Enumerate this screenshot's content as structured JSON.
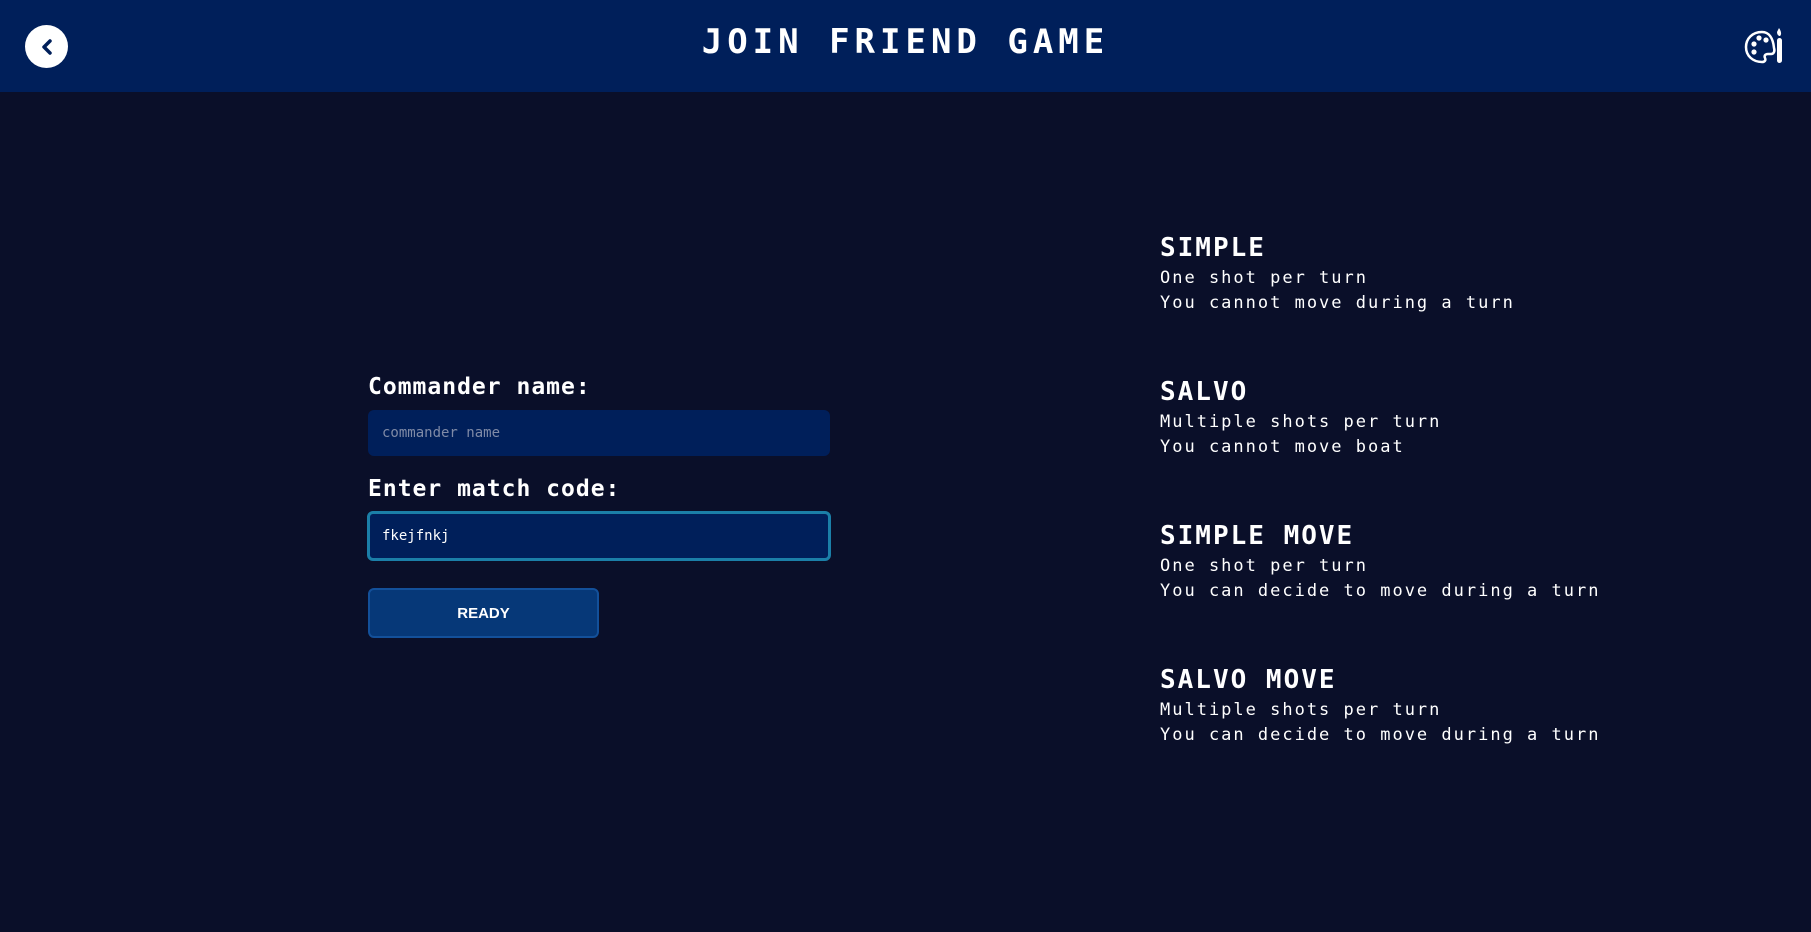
{
  "header": {
    "title": "JOIN FRIEND GAME",
    "back_icon": "chevron-left-icon",
    "theme_icon": "palette-brush-icon"
  },
  "form": {
    "commander_label": "Commander name:",
    "commander_placeholder": "commander name",
    "commander_value": "",
    "code_label": "Enter match code:",
    "code_value": "fkejfnkj",
    "ready_label": "READY"
  },
  "modes": [
    {
      "title": "SIMPLE",
      "lines": [
        "One shot per turn",
        "You cannot move during a turn"
      ]
    },
    {
      "title": "SALVO",
      "lines": [
        "Multiple shots per turn",
        "You cannot move boat"
      ]
    },
    {
      "title": "SIMPLE MOVE",
      "lines": [
        "One shot per turn",
        "You can decide to move during a turn"
      ]
    },
    {
      "title": "SALVO MOVE",
      "lines": [
        "Multiple shots per turn",
        "You can decide to move during a turn"
      ]
    }
  ],
  "colors": {
    "background": "#0a0f29",
    "header": "#001f5a",
    "input_bg": "#001f5a",
    "focus_border": "#1b7fa8",
    "button_bg": "#063878"
  }
}
